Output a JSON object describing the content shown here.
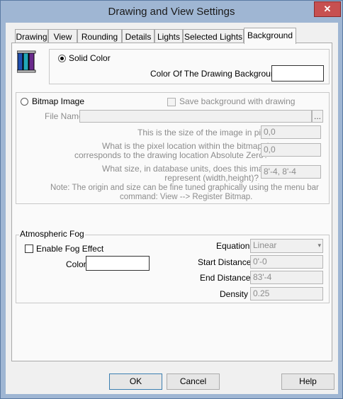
{
  "window": {
    "title": "Drawing and View Settings",
    "close_glyph": "✕"
  },
  "tabs": [
    {
      "label": "Drawing"
    },
    {
      "label": "View"
    },
    {
      "label": "Rounding"
    },
    {
      "label": "Details"
    },
    {
      "label": "Lights"
    },
    {
      "label": "Selected Lights"
    },
    {
      "label": "Background"
    }
  ],
  "active_tab": "Background",
  "solid": {
    "radio_label": "Solid Color",
    "color_label": "Color Of The Drawing Background",
    "selected": true,
    "icon": "color-spools-icon",
    "swatch_color": "#ffffff"
  },
  "bitmap": {
    "radio_label": "Bitmap Image",
    "save_label": "Save background with drawing",
    "file_name_label": "File Name",
    "file_name_value": "",
    "browse_label": "...",
    "size_label": "This is the size of the image in pixels:",
    "size_value": "0,0",
    "pixel_label_1": "What is the pixel location within the bitmap that",
    "pixel_label_2": "corresponds to the drawing location Absolute Zero?",
    "pixel_value": "0,0",
    "db_label_1": "What size, in database units, does this image",
    "db_label_2": "represent (width,height)?",
    "db_value": "8'-4, 8'-4",
    "note_1": "Note: The origin and size can be fine tuned graphically using the menu bar",
    "note_2": "command: View --> Register Bitmap."
  },
  "fog": {
    "group_label": "Atmospheric Fog",
    "enable_label": "Enable Fog Effect",
    "color_label": "Color",
    "equation_label": "Equation",
    "equation_value": "Linear",
    "start_label": "Start Distance",
    "start_value": "0'-0",
    "end_label": "End Distance",
    "end_value": "83'-4",
    "density_label": "Density",
    "density_value": "0.25",
    "fog_color": "#ffffff"
  },
  "buttons": {
    "ok": "OK",
    "cancel": "Cancel",
    "help": "Help"
  }
}
